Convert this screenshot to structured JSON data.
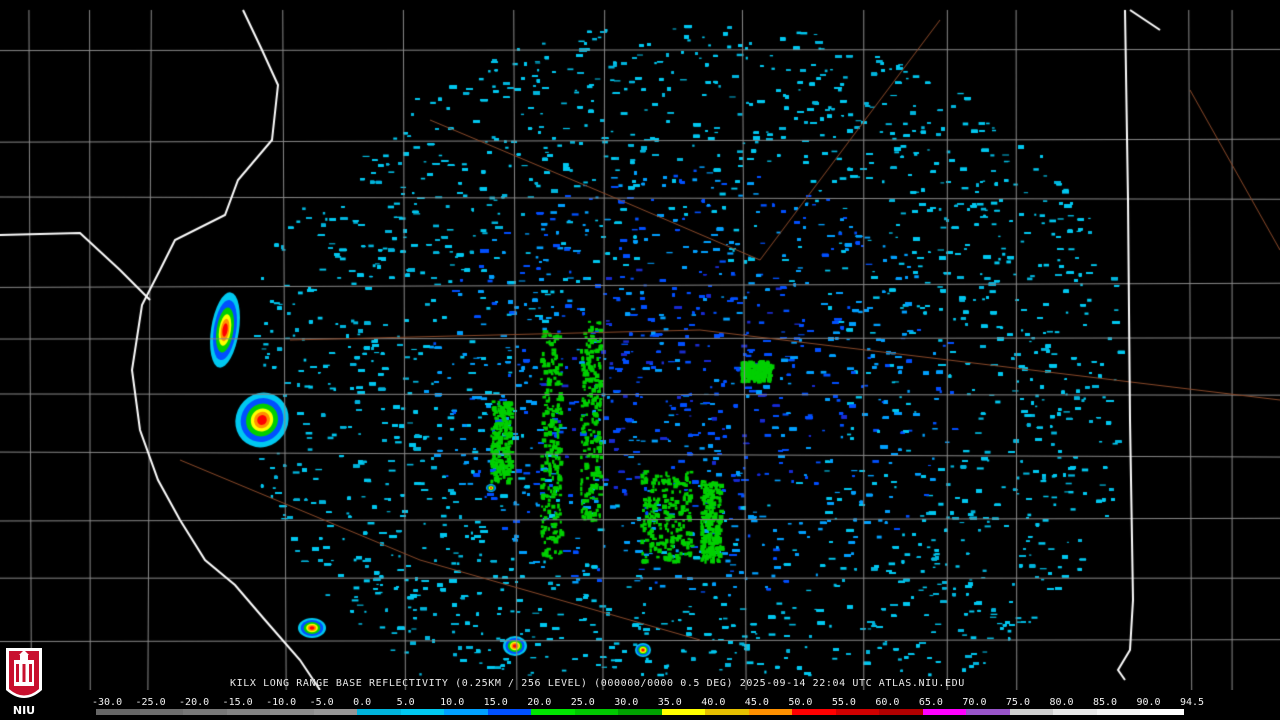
{
  "caption": "KILX LONG RANGE BASE REFLECTIVITY (0.25KM / 256 LEVEL) (000000/0000 0.5 DEG) 2025-09-14 22:04 UTC  ATLAS.NIU.EDU",
  "logo": {
    "text": "NIU",
    "color": "#c8102e"
  },
  "scale": {
    "labels": [
      "-30.0",
      "-25.0",
      "-20.0",
      "-15.0",
      "-10.0",
      "-5.0",
      "0.0",
      "5.0",
      "10.0",
      "15.0",
      "20.0",
      "25.0",
      "30.0",
      "35.0",
      "40.0",
      "45.0",
      "50.0",
      "55.0",
      "60.0",
      "65.0",
      "70.0",
      "75.0",
      "80.0",
      "85.0",
      "90.0",
      "94.5"
    ],
    "colors": [
      "#666666",
      "#6e6e6e",
      "#787878",
      "#828282",
      "#8c8c8c",
      "#969696",
      "#00b4dc",
      "#00c8f0",
      "#00a0ff",
      "#0050ff",
      "#00e600",
      "#00c800",
      "#00a000",
      "#ffff00",
      "#e6c000",
      "#ff9000",
      "#ff0000",
      "#d00000",
      "#b00000",
      "#ff00ff",
      "#9955c9",
      "#cfcfcf",
      "#e8e8e8",
      "#f4f4f4",
      "#ffffff"
    ]
  },
  "map": {
    "background": "#000000",
    "county_line_color": "#8a8a8a",
    "state_line_color": "#ffffff",
    "highway_color": "#8b4a2a"
  }
}
